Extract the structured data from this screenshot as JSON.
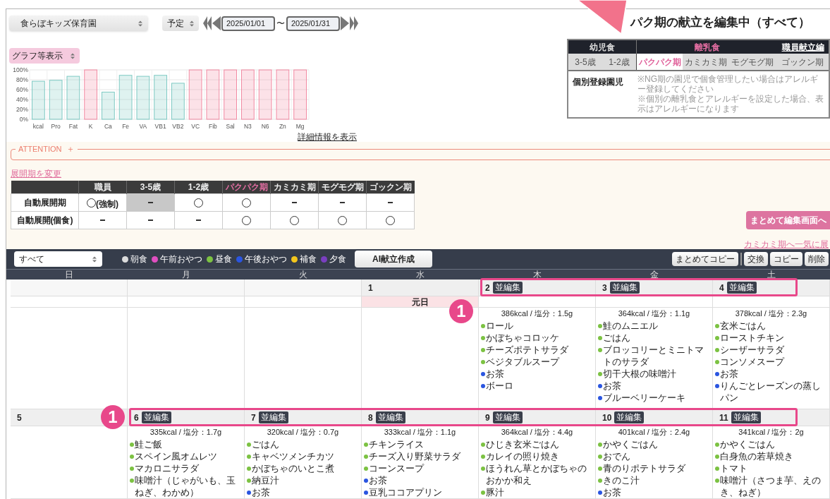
{
  "header": {
    "facility_select": "食らぼキッズ保育園",
    "mode_select": "予定",
    "date_from": "2025/01/01",
    "date_separator": "〜",
    "date_to": "2025/01/31"
  },
  "graph_select": "グラフ等表示",
  "chart": {
    "chart_data": {
      "type": "bar",
      "grid": true,
      "categories": [
        "kcal",
        "Pro",
        "Fat",
        "K",
        "Ca",
        "Fe",
        "VA",
        "VB1",
        "VB2",
        "VC",
        "Fib",
        "Sal",
        "N3",
        "N6",
        "Zn",
        "Mg"
      ],
      "ylim": [
        0,
        100
      ],
      "yticks": [
        {
          "value": 0,
          "label": "0%"
        },
        {
          "value": 20,
          "label": "20%"
        },
        {
          "value": 40,
          "label": "40%"
        },
        {
          "value": 60,
          "label": "60%"
        },
        {
          "value": 80,
          "label": "80%"
        },
        {
          "value": 100,
          "label": "100%"
        }
      ],
      "series": [
        {
          "color": "#7fcac4",
          "values": [
            77,
            79,
            87,
            null,
            55,
            89,
            87,
            89,
            73,
            null,
            null,
            null,
            null,
            null,
            null,
            null
          ]
        },
        {
          "color": "#f28ba3",
          "values": [
            null,
            null,
            null,
            100,
            null,
            null,
            null,
            null,
            null,
            100,
            100,
            100,
            100,
            100,
            100,
            100
          ]
        }
      ]
    }
  },
  "detail_link": "詳細情報を表示",
  "editing_title": "パク期の献立を編集中（すべて）",
  "period_panel": {
    "groups": [
      {
        "label": "幼児食",
        "selected": false,
        "tabs": [
          {
            "label": "3-5歳",
            "selected": false
          },
          {
            "label": "1-2歳",
            "selected": false
          }
        ]
      },
      {
        "label": "離乳食",
        "selected": true,
        "tabs": [
          {
            "label": "パクパク期",
            "selected": true
          },
          {
            "label": "カミカミ期",
            "selected": false
          },
          {
            "label": "モグモグ期",
            "selected": false
          },
          {
            "label": "ゴックン期",
            "selected": false
          }
        ]
      }
    ],
    "staff_link": "職員献立編",
    "individual_label": "個別登録園児",
    "notes": [
      "※NG期の園児で個食管理したい場合はアレルギー登録してください",
      "※個別の離乳食とアレルギーを設定した場合、表示はアレルギーになります"
    ]
  },
  "attention": {
    "label": "ATTENTION",
    "toggle": "＋"
  },
  "expand_link": "展開期を変更",
  "expand_table": {
    "columns": [
      {
        "label": "職員",
        "selected": false
      },
      {
        "label": "3-5歳",
        "selected": false
      },
      {
        "label": "1-2歳",
        "selected": false
      },
      {
        "label": "パクパク期",
        "selected": true
      },
      {
        "label": "カミカミ期",
        "selected": false
      },
      {
        "label": "モグモグ期",
        "selected": false
      },
      {
        "label": "ゴックン期",
        "selected": false
      }
    ],
    "rows": [
      {
        "label": "自動展開期",
        "cells": [
          {
            "kind": "circle",
            "note": "(強制)",
            "disabled": false
          },
          {
            "kind": "dash",
            "disabled": true
          },
          {
            "kind": "circle",
            "disabled": false
          },
          {
            "kind": "circle",
            "disabled": false
          },
          {
            "kind": "dash",
            "disabled": false
          },
          {
            "kind": "dash",
            "disabled": false
          },
          {
            "kind": "dash",
            "disabled": false
          }
        ]
      },
      {
        "label": "自動展開(個食)",
        "cells": [
          {
            "kind": "dash",
            "disabled": false
          },
          {
            "kind": "dash",
            "disabled": false
          },
          {
            "kind": "dash",
            "disabled": false
          },
          {
            "kind": "circle",
            "disabled": false
          },
          {
            "kind": "circle",
            "disabled": false
          },
          {
            "kind": "circle",
            "disabled": false
          },
          {
            "kind": "circle",
            "disabled": false
          }
        ]
      }
    ]
  },
  "bulk_edit_button": "まとめて編集画面へ",
  "expand_all_link": "カミカミ期へ一気に展",
  "toolbar": {
    "filter_select": "すべて",
    "legend": [
      {
        "label": "朝食",
        "color": "#dcdcdc"
      },
      {
        "label": "午前おやつ",
        "color": "#e04fc0"
      },
      {
        "label": "昼食",
        "color": "#7cc242"
      },
      {
        "label": "午後おやつ",
        "color": "#2a55e0"
      },
      {
        "label": "補食",
        "color": "#f3c61c"
      },
      {
        "label": "夕食",
        "color": "#7a3fc0"
      }
    ],
    "ai_button": "AI献立作成",
    "actions": [
      "まとめてコピー",
      "交換",
      "コピー",
      "削除"
    ]
  },
  "calendar": {
    "weekdays": [
      "日",
      "月",
      "火",
      "水",
      "木",
      "金",
      "土"
    ],
    "weeks": [
      {
        "callout": {
          "label": "1",
          "kind": "below"
        },
        "days": [
          {
            "kind": "blank"
          },
          {
            "kind": "blank"
          },
          {
            "kind": "blank"
          },
          {
            "kind": "day",
            "date": "1",
            "holiday": "元日"
          },
          {
            "kind": "day",
            "date": "2",
            "edit_badge": "並編集",
            "summary": "386kcal / 塩分：1.5g",
            "menu": [
              {
                "name": "ロール",
                "color": "#7cc242"
              },
              {
                "name": "かぼちゃコロッケ",
                "color": "#7cc242"
              },
              {
                "name": "チーズポテトサラダ",
                "color": "#7cc242"
              },
              {
                "name": "ベジタブルスープ",
                "color": "#7cc242"
              },
              {
                "name": "お茶",
                "color": "#2a55e0"
              },
              {
                "name": "ボーロ",
                "color": "#2a55e0"
              }
            ]
          },
          {
            "kind": "day",
            "date": "3",
            "edit_badge": "並編集",
            "summary": "364kcal / 塩分：1.1g",
            "menu": [
              {
                "name": "鮭のムニエル",
                "color": "#7cc242"
              },
              {
                "name": "ごはん",
                "color": "#7cc242"
              },
              {
                "name": "ブロッコリーとミニトマトのサラダ",
                "color": "#7cc242"
              },
              {
                "name": "切干大根の味噌汁",
                "color": "#7cc242"
              },
              {
                "name": "お茶",
                "color": "#2a55e0"
              },
              {
                "name": "ブルーベリーケーキ",
                "color": "#2a55e0"
              }
            ]
          },
          {
            "kind": "day",
            "date": "4",
            "edit_badge": "並編集",
            "summary": "378kcal / 塩分：2.3g",
            "menu": [
              {
                "name": "玄米ごはん",
                "color": "#7cc242"
              },
              {
                "name": "ローストチキン",
                "color": "#7cc242"
              },
              {
                "name": "シーザーサラダ",
                "color": "#7cc242"
              },
              {
                "name": "コンソメスープ",
                "color": "#7cc242"
              },
              {
                "name": "お茶",
                "color": "#2a55e0"
              },
              {
                "name": "りんごとレーズンの蒸しパン",
                "color": "#2a55e0"
              }
            ]
          }
        ]
      },
      {
        "callout": {
          "label": "1",
          "kind": "beside"
        },
        "days": [
          {
            "kind": "day",
            "date": "5"
          },
          {
            "kind": "day",
            "date": "6",
            "edit_badge": "並編集",
            "summary": "335kcal / 塩分：1.7g",
            "menu": [
              {
                "name": "鮭ご飯",
                "color": "#7cc242"
              },
              {
                "name": "スペイン風オムレツ",
                "color": "#7cc242"
              },
              {
                "name": "マカロニサラダ",
                "color": "#7cc242"
              },
              {
                "name": "味噌汁（じゃがいも、玉ねぎ、わかめ）",
                "color": "#7cc242"
              }
            ]
          },
          {
            "kind": "day",
            "date": "7",
            "edit_badge": "並編集",
            "summary": "320kcal / 塩分：0.7g",
            "menu": [
              {
                "name": "ごはん",
                "color": "#7cc242"
              },
              {
                "name": "キャベツメンチカツ",
                "color": "#7cc242"
              },
              {
                "name": "かぼちゃのいとこ煮",
                "color": "#7cc242"
              },
              {
                "name": "納豆汁",
                "color": "#7cc242"
              },
              {
                "name": "お茶",
                "color": "#2a55e0"
              }
            ]
          },
          {
            "kind": "day",
            "date": "8",
            "edit_badge": "並編集",
            "summary": "333kcal / 塩分：1.1g",
            "menu": [
              {
                "name": "チキンライス",
                "color": "#7cc242"
              },
              {
                "name": "チーズ入り野菜サラダ",
                "color": "#7cc242"
              },
              {
                "name": "コーンスープ",
                "color": "#7cc242"
              },
              {
                "name": "お茶",
                "color": "#2a55e0"
              },
              {
                "name": "豆乳ココアプリン",
                "color": "#2a55e0"
              }
            ]
          },
          {
            "kind": "day",
            "date": "9",
            "edit_badge": "並編集",
            "summary": "364kcal / 塩分：4.4g",
            "menu": [
              {
                "name": "ひじき玄米ごはん",
                "color": "#7cc242"
              },
              {
                "name": "カレイの照り焼き",
                "color": "#7cc242"
              },
              {
                "name": "ほうれん草とかぼちゃのおかか和え",
                "color": "#7cc242"
              },
              {
                "name": "豚汁",
                "color": "#7cc242"
              }
            ]
          },
          {
            "kind": "day",
            "date": "10",
            "edit_badge": "並編集",
            "summary": "401kcal / 塩分：2.4g",
            "menu": [
              {
                "name": "かやくごはん",
                "color": "#7cc242"
              },
              {
                "name": "おでん",
                "color": "#7cc242"
              },
              {
                "name": "青のりポテトサラダ",
                "color": "#7cc242"
              },
              {
                "name": "きのこ汁",
                "color": "#7cc242"
              },
              {
                "name": "お茶",
                "color": "#2a55e0"
              }
            ]
          },
          {
            "kind": "day",
            "date": "11",
            "edit_badge": "並編集",
            "summary": "341kcal / 塩分：2g",
            "menu": [
              {
                "name": "かやくごはん",
                "color": "#7cc242"
              },
              {
                "name": "白身魚の若草焼き",
                "color": "#7cc242"
              },
              {
                "name": "トマト",
                "color": "#7cc242"
              },
              {
                "name": "味噌汁（さつま芋、えのき、ねぎ）",
                "color": "#7cc242"
              }
            ]
          }
        ]
      }
    ]
  }
}
